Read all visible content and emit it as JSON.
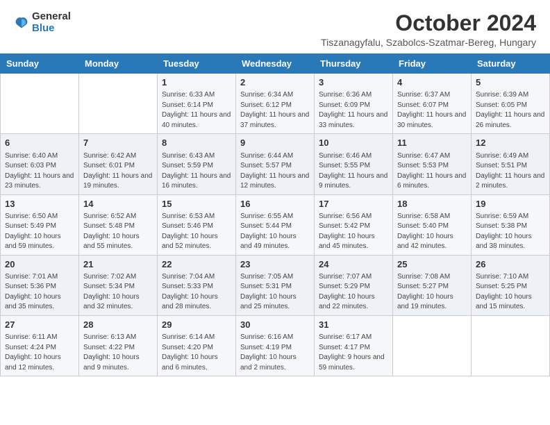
{
  "logo": {
    "general": "General",
    "blue": "Blue"
  },
  "title": "October 2024",
  "location": "Tiszanagyfalu, Szabolcs-Szatmar-Bereg, Hungary",
  "days_of_week": [
    "Sunday",
    "Monday",
    "Tuesday",
    "Wednesday",
    "Thursday",
    "Friday",
    "Saturday"
  ],
  "weeks": [
    [
      {
        "day": "",
        "info": ""
      },
      {
        "day": "",
        "info": ""
      },
      {
        "day": "1",
        "info": "Sunrise: 6:33 AM\nSunset: 6:14 PM\nDaylight: 11 hours and 40 minutes."
      },
      {
        "day": "2",
        "info": "Sunrise: 6:34 AM\nSunset: 6:12 PM\nDaylight: 11 hours and 37 minutes."
      },
      {
        "day": "3",
        "info": "Sunrise: 6:36 AM\nSunset: 6:09 PM\nDaylight: 11 hours and 33 minutes."
      },
      {
        "day": "4",
        "info": "Sunrise: 6:37 AM\nSunset: 6:07 PM\nDaylight: 11 hours and 30 minutes."
      },
      {
        "day": "5",
        "info": "Sunrise: 6:39 AM\nSunset: 6:05 PM\nDaylight: 11 hours and 26 minutes."
      }
    ],
    [
      {
        "day": "6",
        "info": "Sunrise: 6:40 AM\nSunset: 6:03 PM\nDaylight: 11 hours and 23 minutes."
      },
      {
        "day": "7",
        "info": "Sunrise: 6:42 AM\nSunset: 6:01 PM\nDaylight: 11 hours and 19 minutes."
      },
      {
        "day": "8",
        "info": "Sunrise: 6:43 AM\nSunset: 5:59 PM\nDaylight: 11 hours and 16 minutes."
      },
      {
        "day": "9",
        "info": "Sunrise: 6:44 AM\nSunset: 5:57 PM\nDaylight: 11 hours and 12 minutes."
      },
      {
        "day": "10",
        "info": "Sunrise: 6:46 AM\nSunset: 5:55 PM\nDaylight: 11 hours and 9 minutes."
      },
      {
        "day": "11",
        "info": "Sunrise: 6:47 AM\nSunset: 5:53 PM\nDaylight: 11 hours and 6 minutes."
      },
      {
        "day": "12",
        "info": "Sunrise: 6:49 AM\nSunset: 5:51 PM\nDaylight: 11 hours and 2 minutes."
      }
    ],
    [
      {
        "day": "13",
        "info": "Sunrise: 6:50 AM\nSunset: 5:49 PM\nDaylight: 10 hours and 59 minutes."
      },
      {
        "day": "14",
        "info": "Sunrise: 6:52 AM\nSunset: 5:48 PM\nDaylight: 10 hours and 55 minutes."
      },
      {
        "day": "15",
        "info": "Sunrise: 6:53 AM\nSunset: 5:46 PM\nDaylight: 10 hours and 52 minutes."
      },
      {
        "day": "16",
        "info": "Sunrise: 6:55 AM\nSunset: 5:44 PM\nDaylight: 10 hours and 49 minutes."
      },
      {
        "day": "17",
        "info": "Sunrise: 6:56 AM\nSunset: 5:42 PM\nDaylight: 10 hours and 45 minutes."
      },
      {
        "day": "18",
        "info": "Sunrise: 6:58 AM\nSunset: 5:40 PM\nDaylight: 10 hours and 42 minutes."
      },
      {
        "day": "19",
        "info": "Sunrise: 6:59 AM\nSunset: 5:38 PM\nDaylight: 10 hours and 38 minutes."
      }
    ],
    [
      {
        "day": "20",
        "info": "Sunrise: 7:01 AM\nSunset: 5:36 PM\nDaylight: 10 hours and 35 minutes."
      },
      {
        "day": "21",
        "info": "Sunrise: 7:02 AM\nSunset: 5:34 PM\nDaylight: 10 hours and 32 minutes."
      },
      {
        "day": "22",
        "info": "Sunrise: 7:04 AM\nSunset: 5:33 PM\nDaylight: 10 hours and 28 minutes."
      },
      {
        "day": "23",
        "info": "Sunrise: 7:05 AM\nSunset: 5:31 PM\nDaylight: 10 hours and 25 minutes."
      },
      {
        "day": "24",
        "info": "Sunrise: 7:07 AM\nSunset: 5:29 PM\nDaylight: 10 hours and 22 minutes."
      },
      {
        "day": "25",
        "info": "Sunrise: 7:08 AM\nSunset: 5:27 PM\nDaylight: 10 hours and 19 minutes."
      },
      {
        "day": "26",
        "info": "Sunrise: 7:10 AM\nSunset: 5:25 PM\nDaylight: 10 hours and 15 minutes."
      }
    ],
    [
      {
        "day": "27",
        "info": "Sunrise: 6:11 AM\nSunset: 4:24 PM\nDaylight: 10 hours and 12 minutes."
      },
      {
        "day": "28",
        "info": "Sunrise: 6:13 AM\nSunset: 4:22 PM\nDaylight: 10 hours and 9 minutes."
      },
      {
        "day": "29",
        "info": "Sunrise: 6:14 AM\nSunset: 4:20 PM\nDaylight: 10 hours and 6 minutes."
      },
      {
        "day": "30",
        "info": "Sunrise: 6:16 AM\nSunset: 4:19 PM\nDaylight: 10 hours and 2 minutes."
      },
      {
        "day": "31",
        "info": "Sunrise: 6:17 AM\nSunset: 4:17 PM\nDaylight: 9 hours and 59 minutes."
      },
      {
        "day": "",
        "info": ""
      },
      {
        "day": "",
        "info": ""
      }
    ]
  ]
}
